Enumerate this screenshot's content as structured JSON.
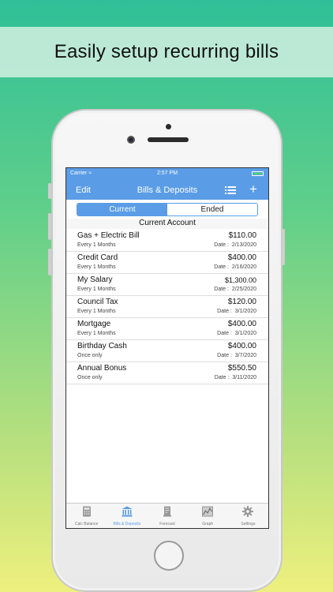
{
  "banner": {
    "text": "Easily setup recurring bills"
  },
  "status_bar": {
    "carrier": "Carrier",
    "time": "2:57 PM"
  },
  "nav": {
    "edit": "Edit",
    "title": "Bills & Deposits",
    "add": "+"
  },
  "segments": {
    "current": "Current",
    "ended": "Ended",
    "selected": "Current"
  },
  "section_header": "Current Account",
  "items": [
    {
      "name": "Gas + Electric Bill",
      "amount": "$110.00",
      "frequency": "Every 1 Months",
      "date_label": "Date :",
      "date": "2/13/2020"
    },
    {
      "name": "Credit Card",
      "amount": "$400.00",
      "frequency": "Every 1 Months",
      "date_label": "Date :",
      "date": "2/16/2020"
    },
    {
      "name": "My Salary",
      "amount": "$1,300.00",
      "frequency": "Every 1 Months",
      "date_label": "Date :",
      "date": "2/25/2020"
    },
    {
      "name": "Council Tax",
      "amount": "$120.00",
      "frequency": "Every 1 Months",
      "date_label": "Date :",
      "date": "3/1/2020"
    },
    {
      "name": "Mortgage",
      "amount": "$400.00",
      "frequency": "Every 1 Months",
      "date_label": "Date :",
      "date": "3/1/2020"
    },
    {
      "name": "Birthday Cash",
      "amount": "$400.00",
      "frequency": "Once only",
      "date_label": "Date :",
      "date": "3/7/2020"
    },
    {
      "name": "Annual Bonus",
      "amount": "$550.50",
      "frequency": "Once only",
      "date_label": "Date :",
      "date": "3/11/2020"
    }
  ],
  "tabs": [
    {
      "label": "Calc Balance",
      "icon": "calculator-icon"
    },
    {
      "label": "Bills & Deposits",
      "icon": "bank-icon",
      "active": true
    },
    {
      "label": "Forecast",
      "icon": "receipt-icon"
    },
    {
      "label": "Graph",
      "icon": "chart-icon"
    },
    {
      "label": "Settings",
      "icon": "gear-icon"
    }
  ],
  "colors": {
    "accent": "#5a9ce6",
    "battery": "#4cd964"
  }
}
